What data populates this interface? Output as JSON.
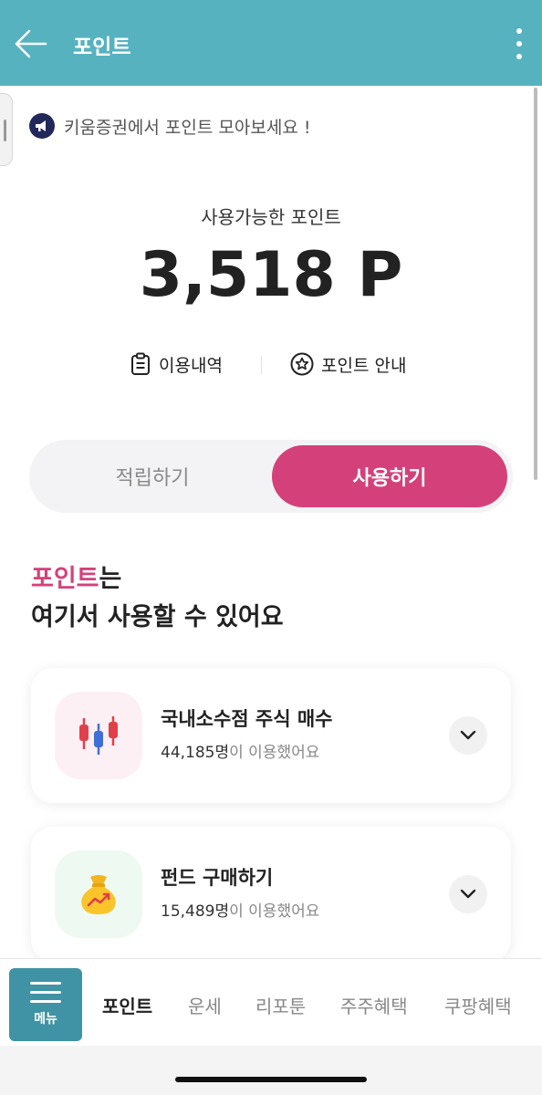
{
  "header": {
    "title": "포인트"
  },
  "notice": {
    "text": "키움증권에서 포인트 모아보세요 !"
  },
  "summary": {
    "label": "사용가능한 포인트",
    "value": "3,518 P"
  },
  "links": {
    "history": "이용내역",
    "guide": "포인트 안내"
  },
  "segment": {
    "earn": "적립하기",
    "use": "사용하기",
    "selected": "use"
  },
  "headline": {
    "highlight": "포인트",
    "rest": "는",
    "line2": "여기서 사용할 수 있어요"
  },
  "cards": [
    {
      "title": "국내소수점 주식 매수",
      "count": "44,185명",
      "suffix": "이 이용했어요",
      "icon": "candlestick-chart-icon"
    },
    {
      "title": "펀드 구매하기",
      "count": "15,489명",
      "suffix": "이 이용했어요",
      "icon": "money-bag-icon"
    }
  ],
  "bottom_nav": {
    "menu_label": "메뉴",
    "items": [
      "포인트",
      "운세",
      "리포툰",
      "주주혜택",
      "쿠팡혜택"
    ],
    "active": "포인트"
  },
  "colors": {
    "appbar": "#57b2bf",
    "accent": "#d4417a",
    "menu": "#3f93a4"
  }
}
